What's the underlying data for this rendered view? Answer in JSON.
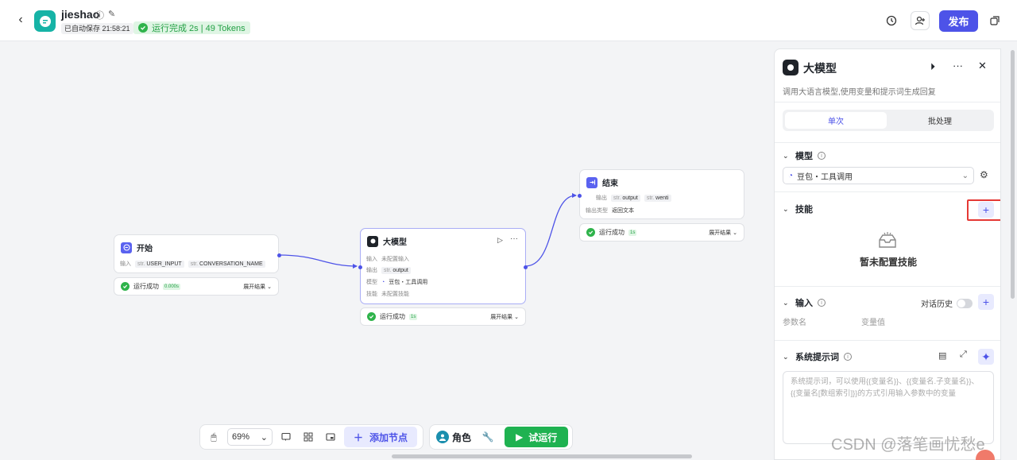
{
  "header": {
    "app_name": "jieshao",
    "autosave": "已自动保存 21:58:21",
    "run_status": "运行完成 2s | 49 Tokens",
    "publish_label": "发布"
  },
  "nodes": {
    "start": {
      "title": "开始",
      "row1_label": "输入",
      "row1_tags": [
        {
          "type": "str.",
          "name": "USER_INPUT"
        },
        {
          "type": "str.",
          "name": "CONVERSATION_NAME"
        }
      ],
      "status": "运行成功",
      "time": "0.000s",
      "expand": "展开结果"
    },
    "llm": {
      "title": "大模型",
      "input_label": "输入",
      "input_value": "未配置输入",
      "output_label": "输出",
      "output_tag_type": "str.",
      "output_tag_name": "output",
      "model_label": "模型",
      "model_value": "豆包・工具调用",
      "skill_label": "技能",
      "skill_value": "未配置技能",
      "status": "运行成功",
      "time": "1s",
      "expand": "展开结果"
    },
    "end": {
      "title": "结束",
      "output_label": "输出",
      "output_tags": [
        {
          "type": "str.",
          "name": "output"
        },
        {
          "type": "str.",
          "name": "wenti"
        }
      ],
      "output_type_label": "输出类型",
      "output_type_value": "返回文本",
      "status": "运行成功",
      "time": "1s",
      "expand": "展开结果"
    }
  },
  "toolbar": {
    "zoom": "69%",
    "add_node": "添加节点",
    "role": "角色",
    "trial_run": "试运行"
  },
  "panel": {
    "title": "大模型",
    "description": "调用大语言模型,使用变量和提示词生成回复",
    "tabs": [
      "单次",
      "批处理"
    ],
    "model_section": "模型",
    "model_value": "豆包・工具调用",
    "skills_section": "技能",
    "skills_empty": "暂未配置技能",
    "input_section": "输入",
    "chat_history": "对话历史",
    "param_name": "参数名",
    "var_value": "变量值",
    "system_prompt_section": "系统提示词",
    "system_prompt_placeholder": "系统提示词，可以使用{{变量名}}、{{变量名.子变量名}}、{{变量名[数组索引]}}的方式引用输入参数中的变量"
  },
  "watermark": "CSDN @落笔画忧愁e",
  "colors": {
    "accent": "#4d53e8",
    "success": "#2fb34b",
    "app_logo": "#16b3a6",
    "highlight_box": "#e53935"
  }
}
